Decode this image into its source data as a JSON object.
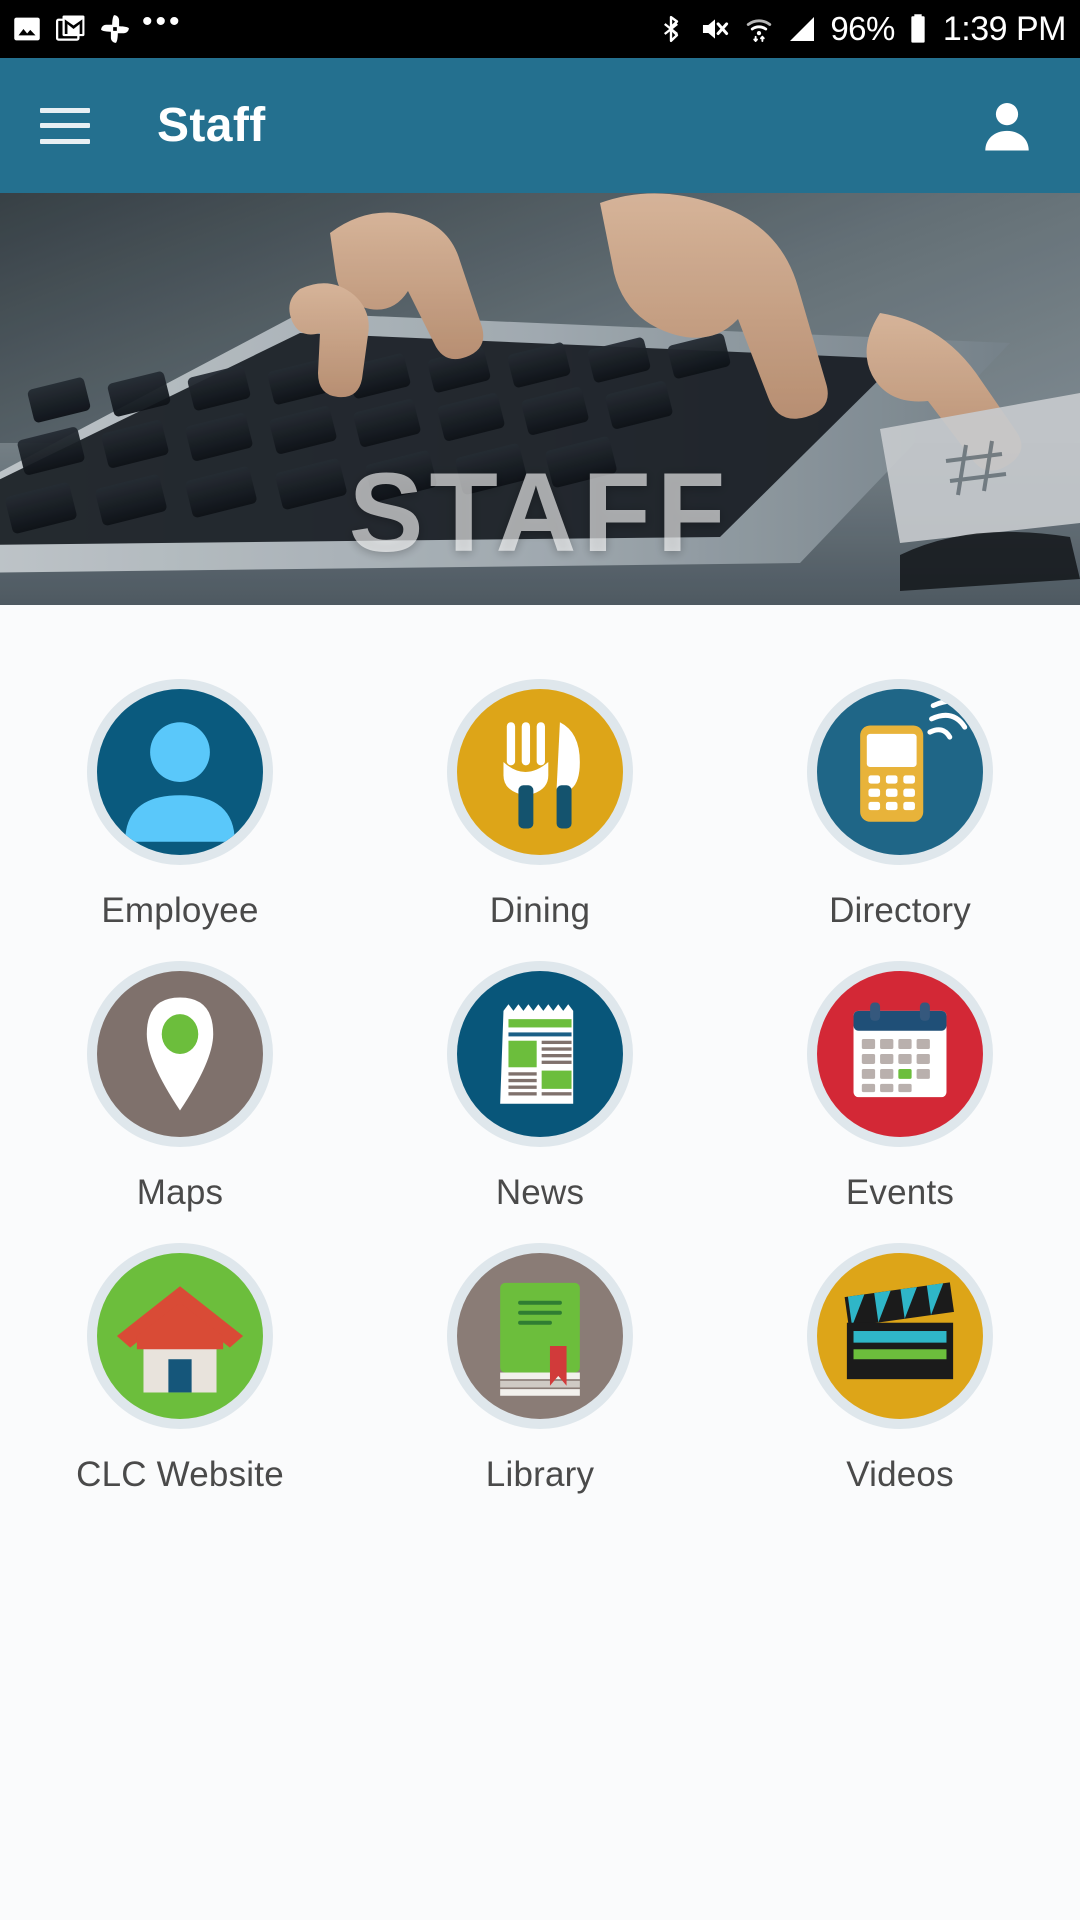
{
  "status_bar": {
    "left_icons": [
      "photo-icon",
      "gmail-icon",
      "google-photos-icon",
      "more-notifications-icon"
    ],
    "more_glyph": "•••",
    "right_icons": [
      "bluetooth-icon",
      "volume-mute-icon",
      "wifi-icon",
      "cellular-signal-icon"
    ],
    "battery_percent": "96%",
    "time": "1:39 PM"
  },
  "app_bar": {
    "menu_icon": "hamburger-menu-icon",
    "title": "Staff",
    "account_icon": "account-person-icon",
    "background_color": "#24708F"
  },
  "hero": {
    "overlay_text": "STAFF",
    "image_description": "hands typing on a laptop keyboard"
  },
  "theme": {
    "page_background": "#fafbfc",
    "badge_ring": "#dfe7ec",
    "label_color": "#4a4a4a",
    "teal_dark": "#0a5a7e",
    "teal_mid": "#1f6687",
    "gold": "#dda518",
    "red": "#d32836",
    "green": "#6cbe3c",
    "brown": "#7f716c"
  },
  "grid": {
    "tiles": [
      {
        "label": "Employee",
        "icon": "person-avatar-icon",
        "circle_color": "#0a5a7e"
      },
      {
        "label": "Dining",
        "icon": "fork-knife-icon",
        "circle_color": "#dda518"
      },
      {
        "label": "Directory",
        "icon": "mobile-phone-icon",
        "circle_color": "#1f6687"
      },
      {
        "label": "Maps",
        "icon": "map-pin-icon",
        "circle_color": "#7f716c"
      },
      {
        "label": "News",
        "icon": "newspaper-icon",
        "circle_color": "#08567a"
      },
      {
        "label": "Events",
        "icon": "calendar-icon",
        "circle_color": "#d32836"
      },
      {
        "label": "CLC Website",
        "icon": "house-home-icon",
        "circle_color": "#6cbe3c"
      },
      {
        "label": "Library",
        "icon": "book-icon",
        "circle_color": "#8a7c76"
      },
      {
        "label": "Videos",
        "icon": "clapperboard-icon",
        "circle_color": "#dda518"
      }
    ]
  }
}
